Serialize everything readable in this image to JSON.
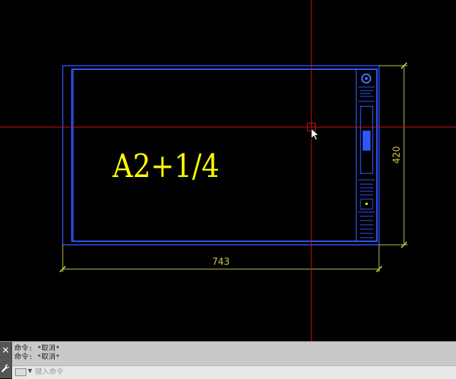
{
  "drawing": {
    "sheet_label": "A2+1/4",
    "dim_width": "743",
    "dim_height": "420"
  },
  "colors": {
    "background": "#000000",
    "frame": "#2f56ff",
    "label": "#ffff00",
    "dimension": "#c8c84a",
    "crosshair": "#d21414"
  },
  "command_line": {
    "history": [
      "命令: *取消*",
      "命令: *取消*"
    ],
    "placeholder": "键入命令"
  },
  "icons": {
    "close": "close-icon",
    "settings": "wrench-icon",
    "prompt": "command-prompt-icon",
    "cursor": "mouse-pointer-icon"
  }
}
